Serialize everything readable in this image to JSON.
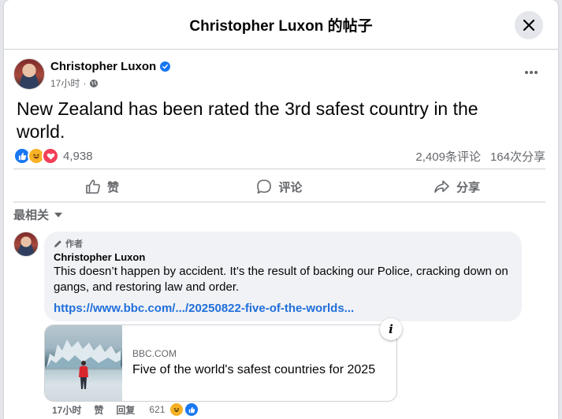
{
  "modal": {
    "title": "Christopher Luxon 的帖子"
  },
  "post": {
    "author": "Christopher Luxon",
    "time": "17小时",
    "text": "New Zealand has been rated the 3rd safest country in the world.",
    "reactions_count": "4,938",
    "comments_count": "2,409条评论",
    "shares_count": "164次分享",
    "reaction_icons": [
      "like-icon",
      "haha-icon",
      "love-icon"
    ]
  },
  "actions": {
    "like": "赞",
    "comment": "评论",
    "share": "分享"
  },
  "sort": {
    "label": "最相关"
  },
  "comment": {
    "badge": "作者",
    "author": "Christopher Luxon",
    "text": "This doesn’t happen by accident. It’s the result of backing our Police, cracking down on gangs, and restoring law and order.",
    "link": "https://www.bbc.com/.../20250822-five-of-the-worlds...",
    "card": {
      "domain": "BBC.COM",
      "title": "Five of the world's safest countries for 2025"
    },
    "time": "17小时",
    "like_label": "赞",
    "reply_label": "回复",
    "reaction_count": "621"
  },
  "colors": {
    "accent": "#1877f2",
    "link": "#216fdb",
    "love": "#f33e58",
    "haha": "#f7b125"
  }
}
